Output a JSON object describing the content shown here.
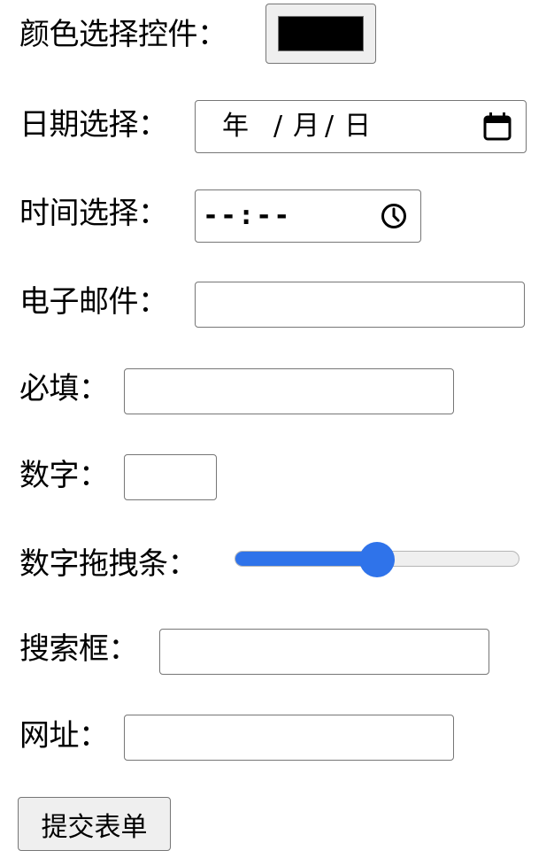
{
  "form": {
    "fields": [
      {
        "label": "颜色选择控件"
      },
      {
        "label": "日期选择"
      },
      {
        "label": "时间选择"
      },
      {
        "label": "电子邮件"
      },
      {
        "label": "必填"
      },
      {
        "label": "数字"
      },
      {
        "label": "数字拖拽条"
      },
      {
        "label": "搜索框"
      },
      {
        "label": "网址"
      }
    ],
    "colon": "：",
    "color": {
      "value": "#000000"
    },
    "date": {
      "year": "年",
      "month": "月",
      "day": "日",
      "sep": "/",
      "icon": "calendar-icon"
    },
    "time": {
      "placeholder": "--:--",
      "icon": "clock-icon"
    },
    "range": {
      "min": 0,
      "max": 100,
      "value": 50,
      "accent": "#2f73ea"
    },
    "submit_label": "提交表单"
  }
}
